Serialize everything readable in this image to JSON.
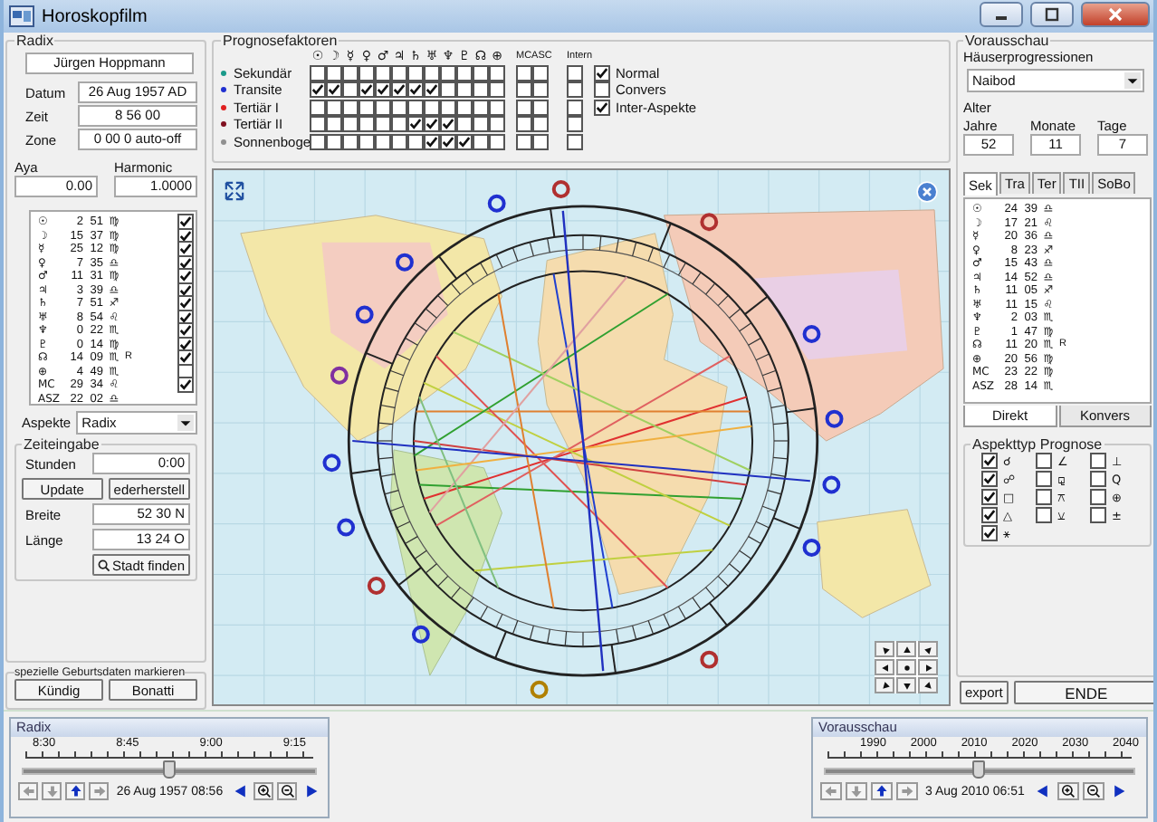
{
  "window": {
    "title": "Horoskopfilm"
  },
  "radix": {
    "title": "Radix",
    "name": "Jürgen Hoppmann",
    "fields": [
      {
        "label": "Datum",
        "value": "26 Aug 1957 AD"
      },
      {
        "label": "Zeit",
        "value": "8 56 00"
      },
      {
        "label": "Zone",
        "value": "0 00 0 auto-off"
      }
    ],
    "aya": {
      "label": "Aya",
      "value": "0.00"
    },
    "harmonic": {
      "label": "Harmonic",
      "value": "1.0000"
    },
    "positions": [
      {
        "kind": "toggle",
        "glyph": "☉",
        "deg": "2",
        "min": "51",
        "sign": "♍",
        "checked": true
      },
      {
        "kind": "toggle",
        "glyph": "☽",
        "deg": "15",
        "min": "37",
        "sign": "♍",
        "checked": true
      },
      {
        "kind": "toggle",
        "glyph": "☿",
        "deg": "25",
        "min": "12",
        "sign": "♍",
        "checked": true
      },
      {
        "kind": "toggle",
        "glyph": "♀",
        "deg": "7",
        "min": "35",
        "sign": "♎",
        "checked": true
      },
      {
        "kind": "toggle",
        "glyph": "♂",
        "deg": "11",
        "min": "31",
        "sign": "♍",
        "checked": true
      },
      {
        "kind": "toggle",
        "glyph": "♃",
        "deg": "3",
        "min": "39",
        "sign": "♎",
        "checked": true
      },
      {
        "kind": "toggle",
        "glyph": "♄",
        "deg": "7",
        "min": "51",
        "sign": "♐",
        "checked": true
      },
      {
        "kind": "toggle",
        "glyph": "♅",
        "deg": "8",
        "min": "54",
        "sign": "♌",
        "checked": true
      },
      {
        "kind": "toggle",
        "glyph": "♆",
        "deg": "0",
        "min": "22",
        "sign": "♏",
        "checked": true
      },
      {
        "kind": "toggle",
        "glyph": "♇",
        "deg": "0",
        "min": "14",
        "sign": "♍",
        "checked": true
      },
      {
        "kind": "toggle",
        "glyph": "☊",
        "deg": "14",
        "min": "09",
        "sign": "♏",
        "retro": "R",
        "checked": true
      },
      {
        "kind": "toggle",
        "glyph": "⊕",
        "deg": "4",
        "min": "49",
        "sign": "♏",
        "checked": false
      },
      {
        "kind": "toggle",
        "glyph": "MC",
        "deg": "29",
        "min": "34",
        "sign": "♌",
        "checked": true
      },
      {
        "kind": "fixed",
        "glyph": "ASZ",
        "deg": "22",
        "min": "02",
        "sign": "♎"
      }
    ],
    "aspects": {
      "label": "Aspekte",
      "value": "Radix"
    }
  },
  "time_input": {
    "title": "Zeiteingabe",
    "hours": {
      "label": "Stunden",
      "value": "0:00"
    },
    "buttons": [
      "Update",
      "ederherstell"
    ],
    "latitude": {
      "label": "Breite",
      "value": "52 30 N"
    },
    "longitude": {
      "label": "Länge",
      "value": "13 24 O"
    },
    "find_city": "Stadt finden"
  },
  "special_dates": {
    "title": "spezielle Geburtsdaten markieren",
    "buttons": [
      "Kündig",
      "Bonatti"
    ]
  },
  "prognosis_factors": {
    "title": "Prognosefaktoren",
    "glyphs": [
      "☉",
      "☽",
      "☿",
      "♀",
      "♂",
      "♃",
      "♄",
      "♅",
      "♆",
      "♇",
      "☊",
      "⊕"
    ],
    "angle_header": "MCASC",
    "intern_header": "Intern",
    "rows": [
      {
        "label": "Sekundär",
        "color": "#1a9a8a",
        "checks": [
          false,
          false,
          false,
          false,
          false,
          false,
          false,
          false,
          false,
          false,
          false,
          false
        ],
        "angles": [
          false,
          false
        ],
        "intern": false,
        "option": {
          "label": "Normal",
          "checked": true
        }
      },
      {
        "label": "Transite",
        "color": "#2030d0",
        "checks": [
          true,
          true,
          false,
          true,
          true,
          true,
          true,
          true,
          false,
          false,
          false,
          false
        ],
        "angles": [
          false,
          false
        ],
        "intern": false,
        "option": {
          "label": "Convers",
          "checked": false
        }
      },
      {
        "label": "Tertiär I",
        "color": "#e02020",
        "checks": [
          false,
          false,
          false,
          false,
          false,
          false,
          false,
          false,
          false,
          false,
          false,
          false
        ],
        "angles": [
          false,
          false
        ],
        "intern": false,
        "option": {
          "label": "Inter-Aspekte",
          "checked": true
        }
      },
      {
        "label": "Tertiär II",
        "color": "#801020",
        "checks": [
          false,
          false,
          false,
          false,
          false,
          false,
          true,
          true,
          true,
          false,
          false,
          false
        ],
        "angles": [
          false,
          false
        ],
        "intern": false
      },
      {
        "label": "Sonnenboge",
        "color": "#909090",
        "checks": [
          false,
          false,
          false,
          false,
          false,
          false,
          false,
          true,
          true,
          true,
          false,
          false
        ],
        "angles": [
          false,
          false
        ],
        "intern": false
      }
    ]
  },
  "preview": {
    "title": "Vorausschau",
    "houses_label": "Häuserprogressionen",
    "houses_value": "Naibod",
    "age_label": "Alter",
    "age": [
      {
        "label": "Jahre",
        "value": "52"
      },
      {
        "label": "Monate",
        "value": "11"
      },
      {
        "label": "Tage",
        "value": "7"
      }
    ],
    "tabs": [
      {
        "label": "Sek",
        "selected": true
      },
      {
        "label": "Tra",
        "selected": false
      },
      {
        "label": "Ter",
        "selected": false
      },
      {
        "label": "TII",
        "selected": false
      },
      {
        "label": "SoBo",
        "selected": false
      }
    ],
    "positions": [
      {
        "glyph": "☉",
        "deg": "24",
        "min": "39",
        "sign": "♎"
      },
      {
        "glyph": "☽",
        "deg": "17",
        "min": "21",
        "sign": "♌"
      },
      {
        "glyph": "☿",
        "deg": "20",
        "min": "36",
        "sign": "♎"
      },
      {
        "glyph": "♀",
        "deg": "8",
        "min": "23",
        "sign": "♐"
      },
      {
        "glyph": "♂",
        "deg": "15",
        "min": "43",
        "sign": "♎"
      },
      {
        "glyph": "♃",
        "deg": "14",
        "min": "52",
        "sign": "♎"
      },
      {
        "glyph": "♄",
        "deg": "11",
        "min": "05",
        "sign": "♐"
      },
      {
        "glyph": "♅",
        "deg": "11",
        "min": "15",
        "sign": "♌"
      },
      {
        "glyph": "♆",
        "deg": "2",
        "min": "03",
        "sign": "♏"
      },
      {
        "glyph": "♇",
        "deg": "1",
        "min": "47",
        "sign": "♍"
      },
      {
        "glyph": "☊",
        "deg": "11",
        "min": "20",
        "sign": "♏",
        "retro": "R"
      },
      {
        "glyph": "⊕",
        "deg": "20",
        "min": "56",
        "sign": "♍"
      },
      {
        "glyph": "MC",
        "deg": "23",
        "min": "22",
        "sign": "♍"
      },
      {
        "glyph": "ASZ",
        "deg": "28",
        "min": "14",
        "sign": "♏"
      }
    ],
    "modes": [
      {
        "label": "Direkt",
        "selected": true
      },
      {
        "label": "Konvers",
        "selected": false
      }
    ]
  },
  "aspect_types": {
    "title": "Aspekttyp Prognose",
    "items": [
      {
        "glyph": "☌",
        "checked": true
      },
      {
        "glyph": "∠",
        "checked": false
      },
      {
        "glyph": "⊥",
        "checked": false
      },
      {
        "glyph": "☍",
        "checked": true
      },
      {
        "glyph": "⚼",
        "checked": false
      },
      {
        "glyph": "Q",
        "checked": false
      },
      {
        "glyph": "□",
        "checked": true
      },
      {
        "glyph": "⚻",
        "checked": false
      },
      {
        "glyph": "⊕",
        "checked": false
      },
      {
        "glyph": "△",
        "checked": true
      },
      {
        "glyph": "⚺",
        "checked": false
      },
      {
        "glyph": "±",
        "checked": false
      },
      {
        "glyph": "⚹",
        "checked": true
      }
    ]
  },
  "actions": [
    "export",
    "ENDE"
  ],
  "timeline_radix": {
    "title": "Radix",
    "ticks": [
      "8:30",
      "8:45",
      "9:00",
      "9:15"
    ],
    "level": 0.5,
    "date": "26 Aug 1957 08:56"
  },
  "timeline_preview": {
    "title": "Vorausschau",
    "ticks": [
      "1990",
      "2000",
      "2010",
      "2020",
      "2030",
      "2040"
    ],
    "level": 0.5,
    "date": "3 Aug 2010 06:51"
  }
}
